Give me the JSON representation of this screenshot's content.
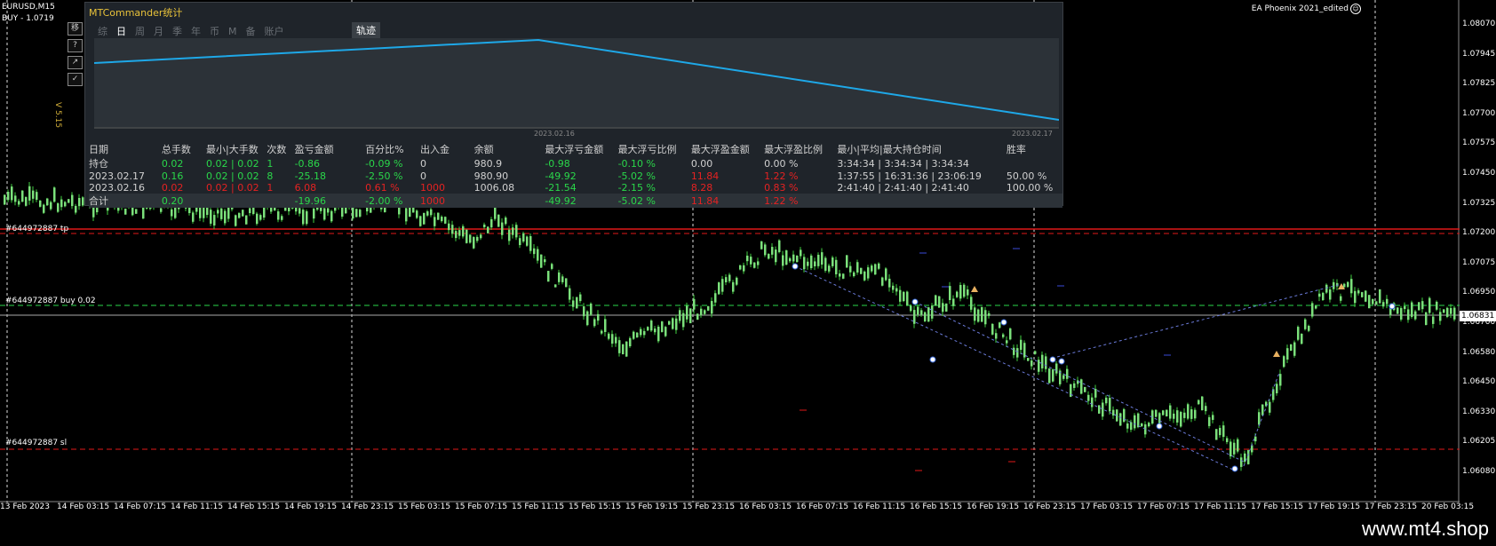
{
  "symbol_label": "EURUSD,M15",
  "order_label": "BUY - 1.0719",
  "ea_name": "EA Phoenix 2021_edited",
  "side_buttons": [
    "移",
    "?",
    "↗",
    "✓"
  ],
  "version": "V 5.15",
  "price_ticks": [
    "1.08070",
    "1.07945",
    "1.07825",
    "1.07700",
    "1.07575",
    "1.07450",
    "1.07325",
    "1.07200",
    "1.07075",
    "1.06950",
    "1.06831",
    "1.06700",
    "1.06580",
    "1.06450",
    "1.06330",
    "1.06205",
    "1.06080"
  ],
  "current_price": "1.06831",
  "time_ticks": [
    "13 Feb 2023",
    "14 Feb 03:15",
    "14 Feb 07:15",
    "14 Feb 11:15",
    "14 Feb 15:15",
    "14 Feb 19:15",
    "14 Feb 23:15",
    "15 Feb 03:15",
    "15 Feb 07:15",
    "15 Feb 11:15",
    "15 Feb 15:15",
    "15 Feb 19:15",
    "15 Feb 23:15",
    "16 Feb 03:15",
    "16 Feb 07:15",
    "16 Feb 11:15",
    "16 Feb 15:15",
    "16 Feb 19:15",
    "16 Feb 23:15",
    "17 Feb 03:15",
    "17 Feb 07:15",
    "17 Feb 11:15",
    "17 Feb 15:15",
    "17 Feb 19:15",
    "17 Feb 23:15",
    "20 Feb 03:15"
  ],
  "line_labels": {
    "tp": "#644972887 tp",
    "buy": "#644972887 buy 0.02",
    "sl": "#644972887 sl"
  },
  "colors": {
    "red_line": "#e01818",
    "profit": "#2ad74a",
    "loss": "#e52222",
    "curve": "#1ea8e8",
    "title": "#e8c23a"
  },
  "panel": {
    "title": "MTCommander统计",
    "tabs": [
      "综",
      "日",
      "周",
      "月",
      "季",
      "年",
      "币",
      "M",
      "备",
      "账户"
    ],
    "active_tab": "日",
    "track_tab": "轨迹",
    "plot_dates": [
      "2023.02.16",
      "2023.02.17"
    ],
    "headers": [
      "日期",
      "总手数",
      "最小|大手数",
      "次数",
      "盈亏金额",
      "百分比%",
      "出入金",
      "余额",
      "最大浮亏金额",
      "最大浮亏比例",
      "最大浮盈金额",
      "最大浮盈比例",
      "最小|平均|最大持仓时间",
      "胜率"
    ],
    "rows": [
      {
        "cells": [
          "持仓",
          "0.02",
          "0.02 | 0.02",
          "1",
          "-0.86",
          "-0.09 %",
          "0",
          "980.9",
          "-0.98",
          "-0.10 %",
          "0.00",
          "0.00 %",
          "3:34:34 | 3:34:34 | 3:34:34",
          ""
        ],
        "classes": [
          "w",
          "g",
          "g",
          "g",
          "g",
          "g",
          "w",
          "w",
          "g",
          "g",
          "w",
          "w",
          "w",
          "w"
        ]
      },
      {
        "cells": [
          "2023.02.17",
          "0.16",
          "0.02 | 0.02",
          "8",
          "-25.18",
          "-2.50 %",
          "0",
          "980.90",
          "-49.92",
          "-5.02 %",
          "11.84",
          "1.22 %",
          "1:37:55 | 16:31:36 | 23:06:19",
          "50.00 %"
        ],
        "classes": [
          "w",
          "g",
          "g",
          "g",
          "g",
          "g",
          "w",
          "w",
          "g",
          "g",
          "r",
          "r",
          "w",
          "w"
        ]
      },
      {
        "cells": [
          "2023.02.16",
          "0.02",
          "0.02 | 0.02",
          "1",
          "6.08",
          "0.61 %",
          "1000",
          "1006.08",
          "-21.54",
          "-2.15 %",
          "8.28",
          "0.83 %",
          "2:41:40 | 2:41:40 | 2:41:40",
          "100.00 %"
        ],
        "classes": [
          "w",
          "r",
          "r",
          "r",
          "r",
          "r",
          "r",
          "w",
          "g",
          "g",
          "r",
          "r",
          "w",
          "w"
        ]
      },
      {
        "cells": [
          "合计",
          "0.20",
          "",
          "",
          "-19.96",
          "-2.00 %",
          "1000",
          "",
          "-49.92",
          "-5.02 %",
          "11.84",
          "1.22 %",
          "",
          ""
        ],
        "classes": [
          "w",
          "g",
          "g",
          "g",
          "g",
          "g",
          "r",
          "w",
          "g",
          "g",
          "r",
          "r",
          "w",
          "w"
        ]
      }
    ]
  },
  "watermark": "www.mt4.shop"
}
